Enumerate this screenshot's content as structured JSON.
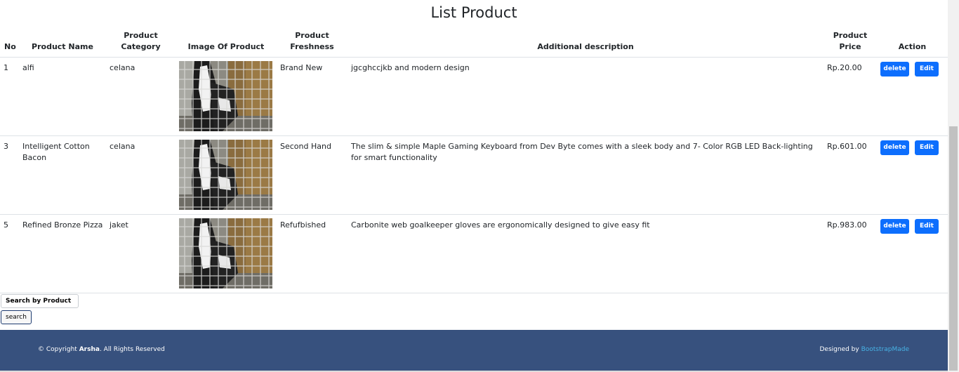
{
  "page": {
    "title": "List Product"
  },
  "table": {
    "headers": {
      "no": "No",
      "name": "Product Name",
      "category_line1": "Product",
      "category_line2": "Category",
      "image": "Image Of Product",
      "freshness": "Product Freshness",
      "description": "Additional description",
      "price": "Product Price",
      "action": "Action"
    },
    "rows": [
      {
        "no": "1",
        "name": "alfi",
        "category": "celana",
        "image": "cat-behind-cage-image",
        "freshness": "Brand New",
        "description": "jgcghccjkb and modern design",
        "price": "Rp.20.00",
        "delete_label": "delete",
        "edit_label": "Edit"
      },
      {
        "no": "3",
        "name": "Intelligent Cotton Bacon",
        "category": "celana",
        "image": "cat-behind-cage-image",
        "freshness": "Second Hand",
        "description": "The slim & simple Maple Gaming Keyboard from Dev Byte comes with a sleek body and 7- Color RGB LED Back-lighting for smart functionality",
        "price": "Rp.601.00",
        "delete_label": "delete",
        "edit_label": "Edit"
      },
      {
        "no": "5",
        "name": "Refined Bronze Pizza",
        "category": "jaket",
        "image": "cat-behind-cage-image",
        "freshness": "Refufbished",
        "description": "Carbonite web goalkeeper gloves are ergonomically designed to give easy fit",
        "price": "Rp.983.00",
        "delete_label": "delete",
        "edit_label": "Edit"
      }
    ]
  },
  "search": {
    "placeholder": "Search by Product Name",
    "button_label": "search"
  },
  "footer": {
    "copyright_prefix": "© Copyright ",
    "brand": "Arsha",
    "copyright_suffix": ". All Rights Reserved",
    "designed_by": "Designed by ",
    "designer_link": "BootstrapMade"
  },
  "colors": {
    "primary_button": "#0d6efd",
    "footer_bg": "#37517e",
    "footer_link": "#47b2e4"
  }
}
